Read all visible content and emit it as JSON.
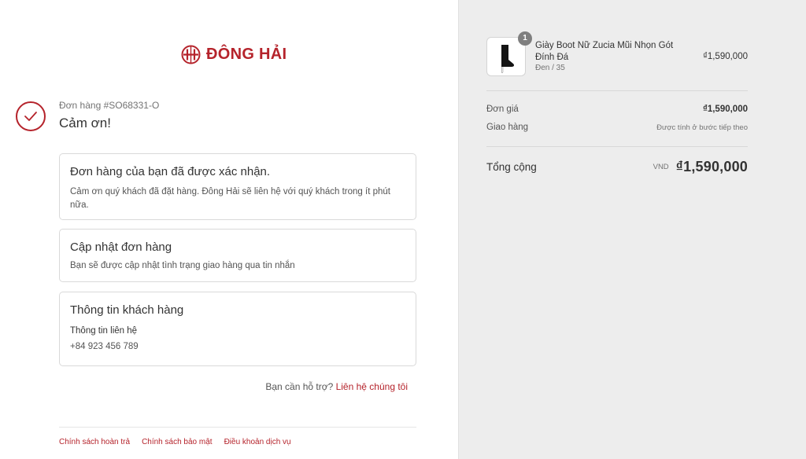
{
  "brand": {
    "name": "ĐÔNG HẢI",
    "color": "#b5232b"
  },
  "header": {
    "order_number": "Đơn hàng #SO68331-O",
    "thanks": "Cảm ơn!"
  },
  "confirmation": {
    "title": "Đơn hàng của bạn đã được xác nhận.",
    "body": "Cảm ơn quý khách đã đặt hàng. Đông Hải sẽ liên hệ với quý khách trong ít phút nữa."
  },
  "updates": {
    "title": "Cập nhật đơn hàng",
    "body": "Bạn sẽ được cập nhật tình trạng giao hàng qua tin nhắn"
  },
  "customer": {
    "title": "Thông tin khách hàng",
    "contact_label": "Thông tin liên hệ",
    "phone": "+84 923 456 789"
  },
  "help": {
    "question": "Bạn cần hỗ trợ?",
    "link": "Liên hệ chúng tôi"
  },
  "footer": {
    "links": [
      "Chính sách hoàn trả",
      "Chính sách bảo mật",
      "Điều khoản dịch vụ"
    ]
  },
  "summary": {
    "product": {
      "name": "Giày Boot Nữ Zucia Mũi Nhọn Gót Đính Đá",
      "variant": "Đen / 35",
      "price": "₫1,590,000",
      "quantity": "1",
      "image_icon": "ankle-boot-icon"
    },
    "unit_price_label": "Đơn giá",
    "unit_price": "₫1,590,000",
    "shipping_label": "Giao hàng",
    "shipping_note": "Được tính ở bước tiếp theo",
    "total_label": "Tổng cộng",
    "currency": "VND",
    "total": "₫1,590,000"
  }
}
